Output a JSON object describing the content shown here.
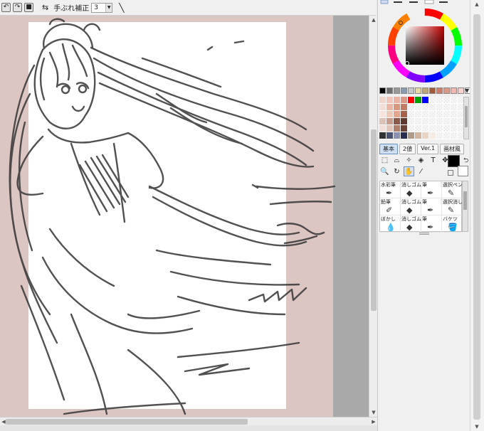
{
  "toolbar": {
    "undo_icon": "undo-icon",
    "redo_icon": "redo-icon",
    "stop_icon": "stop-icon",
    "flip_icon": "flip-horizontal-icon",
    "stabilizer_label": "手ぶれ補正",
    "stabilizer_value": "3",
    "pen_line_icon": "straight-line-icon"
  },
  "canvas": {
    "background_color": "#dcc6c1",
    "paper_color": "#ffffff"
  },
  "palette": {
    "top_row_colors": [
      "#000000",
      "#6d6d6d",
      "#999999",
      "#8a9bb0",
      "#c9c9c9",
      "#e8d9a8",
      "#bda77a",
      "#a05a3c",
      "#c77f6e",
      "#d99a8a",
      "#f0b8b0",
      "#f5d2cd",
      "#ffffff"
    ],
    "grid_colors": [
      "#f2d5cc",
      "#efc7ba",
      "#e8b3a2",
      "#d99a85",
      "#ff0000",
      "#00a000",
      "#0000ff",
      "#ffffff",
      "#ffffff",
      "#ffffff",
      "#ffffff",
      "#ffffff",
      "#f5ded6",
      "#eab6a3",
      "#d7987f",
      "#c27a63",
      "#ffffff",
      "#ffffff",
      "#ffffff",
      "#ffffff",
      "#ffffff",
      "#ffffff",
      "#ffffff",
      "#ffffff",
      "#f7e5dd",
      "#efc8b8",
      "#e6a58d",
      "#a8624c",
      "#ffffff",
      "#ffffff",
      "#ffffff",
      "#ffffff",
      "#ffffff",
      "#ffffff",
      "#ffffff",
      "#ffffff",
      "#dfc2b6",
      "#c89c8b",
      "#8c5a4a",
      "#5e3a2e",
      "#ffffff",
      "#ffffff",
      "#ffffff",
      "#ffffff",
      "#ffffff",
      "#ffffff",
      "#ffffff",
      "#ffffff",
      "#f0e0d8",
      "#e2c5b8",
      "#b07f6c",
      "#6b4438",
      "#ffffff",
      "#ffffff",
      "#ffffff",
      "#ffffff",
      "#ffffff",
      "#ffffff",
      "#ffffff",
      "#ffffff",
      "#333333",
      "#4a5070",
      "#8a92b0",
      "#2a2f50",
      "#b09a88",
      "#d2b59e",
      "#e9d4c4",
      "#f6ebe3",
      "#ffffff",
      "#ffffff",
      "#ffffff",
      "#ffffff"
    ]
  },
  "tool_tabs": [
    "基本",
    "2値",
    "Ver.1",
    "画材風"
  ],
  "tools": [
    "rect-select-icon",
    "lasso-icon",
    "magic-wand-icon",
    "bucket-select-icon",
    "text-icon",
    "move-icon",
    "zoom-icon",
    "rotate-icon",
    "hand-icon",
    "eyedropper-icon"
  ],
  "tool_glyphs": [
    "⬚",
    "⌓",
    "✧",
    "◈",
    "T",
    "✥",
    "🔍",
    "↻",
    "✋",
    "⁄"
  ],
  "brushes": [
    {
      "label": "水彩筆",
      "icon": "✒"
    },
    {
      "label": "消しゴム",
      "icon": "◆"
    },
    {
      "label": "筆",
      "icon": "✒"
    },
    {
      "label": "選択ペン",
      "icon": "✎"
    },
    {
      "label": "鉛筆",
      "icon": "✐"
    },
    {
      "label": "消しゴム",
      "icon": "◆"
    },
    {
      "label": "筆",
      "icon": "✒"
    },
    {
      "label": "選択消し",
      "icon": "✎"
    },
    {
      "label": "ぼかし",
      "icon": "💧"
    },
    {
      "label": "消しゴム",
      "icon": "◆"
    },
    {
      "label": "筆",
      "icon": "✒"
    },
    {
      "label": "バケツ",
      "icon": "🪣"
    }
  ],
  "current_colors": {
    "foreground": "#000000",
    "background": "#ffffff"
  }
}
